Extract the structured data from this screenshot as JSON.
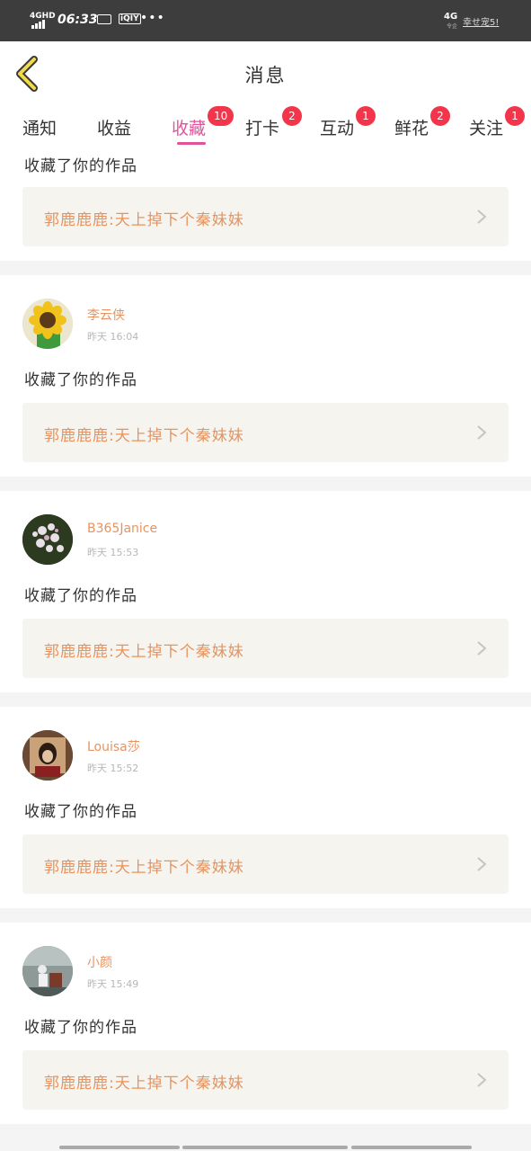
{
  "status_bar": {
    "network_left": "4GHD",
    "time": "06:33",
    "icon_label": "iQIY",
    "dots": "•••",
    "network_right": "4G",
    "network_right_sub": "令企",
    "carrier": "幸せ宠5!"
  },
  "header": {
    "title": "消息"
  },
  "tabs": [
    {
      "label": "通知",
      "badge": ""
    },
    {
      "label": "收益",
      "badge": ""
    },
    {
      "label": "收藏",
      "badge": "10"
    },
    {
      "label": "打卡",
      "badge": "2"
    },
    {
      "label": "互动",
      "badge": "1"
    },
    {
      "label": "鲜花",
      "badge": "2"
    },
    {
      "label": "关注",
      "badge": "1"
    }
  ],
  "active_tab": "收藏",
  "messages": [
    {
      "user": "",
      "time": "",
      "action": "收藏了你的作品",
      "work": "郭鹿鹿鹿:天上掉下个秦妹妹"
    },
    {
      "user": "李云侠",
      "time": "昨天 16:04",
      "action": "收藏了你的作品",
      "work": "郭鹿鹿鹿:天上掉下个秦妹妹"
    },
    {
      "user": "B365Janice",
      "time": "昨天 15:53",
      "action": "收藏了你的作品",
      "work": "郭鹿鹿鹿:天上掉下个秦妹妹"
    },
    {
      "user": "Louisa莎",
      "time": "昨天 15:52",
      "action": "收藏了你的作品",
      "work": "郭鹿鹿鹿:天上掉下个秦妹妹"
    },
    {
      "user": "小颜",
      "time": "昨天 15:49",
      "action": "收藏了你的作品",
      "work": "郭鹿鹿鹿:天上掉下个秦妹妹"
    }
  ],
  "colors": {
    "accent": "#e0539a",
    "badge": "#f2354b",
    "username": "#e8935f",
    "status_bar": "#3d3d3d"
  }
}
